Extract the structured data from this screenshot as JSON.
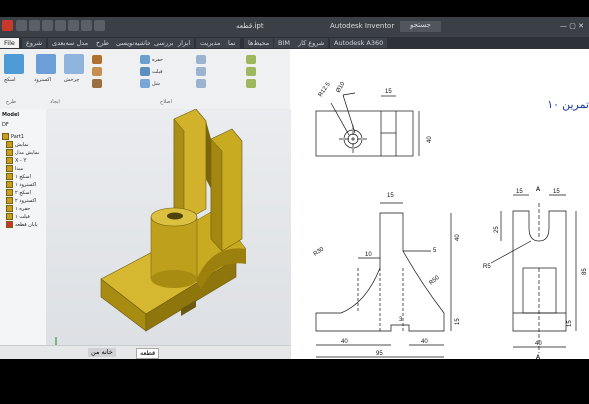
{
  "window": {
    "title": "Autodesk Inventor",
    "doc_name": "قطعه.ipt",
    "search_placeholder": "جستجو",
    "file_menu": "File"
  },
  "tabs": [
    {
      "label": "شروع"
    },
    {
      "label": "مدل سه‌بعدی"
    },
    {
      "label": "طرح"
    },
    {
      "label": "حاشیه‌نویسی"
    },
    {
      "label": "بررسی"
    },
    {
      "label": "ابزار"
    },
    {
      "label": "مدیریت"
    },
    {
      "label": "نما"
    },
    {
      "label": "محیط‌ها"
    },
    {
      "label": "BIM"
    },
    {
      "label": "شروع کار"
    },
    {
      "label": "Autodesk A360"
    }
  ],
  "ribbon": {
    "groups": [
      "طرح",
      "ایجاد",
      "اصلاح"
    ],
    "buttons": [
      "اکسترود",
      "چرخش",
      "حفره",
      "فیلت",
      "شل",
      "اسکچ"
    ]
  },
  "browser": {
    "header": "Model",
    "filter": "DF",
    "items": [
      "Part1",
      "نمایش",
      "نمایش مدل",
      "X - Y",
      "مبدا",
      "اسکچ ۱",
      "اکسترود ۱",
      "اسکچ ۲",
      "اکسترود ۲",
      "حفره ۱",
      "فیلت ۱",
      "پایان قطعه"
    ]
  },
  "status": {
    "home_tab": "خانه من",
    "doc_tab": "قطعه"
  },
  "drawing": {
    "title": "تمرین ۱۰",
    "dims": {
      "d_r125": "R12.5",
      "d_d10": "Ø10",
      "d_15a": "15",
      "d_40v": "40",
      "d_15b": "15",
      "d_r30": "R30",
      "d_10": "10",
      "d_5": "5",
      "d_40v2": "40",
      "d_r50": "R50",
      "d_15c": "15",
      "d_3": "3",
      "d_40a": "40",
      "d_40b": "40",
      "d_95": "95",
      "d_15d": "15",
      "d_15e": "15",
      "d_25": "25",
      "d_r5": "R5",
      "d_85": "85",
      "d_15f": "15",
      "d_40h": "40",
      "sec_a1": "A",
      "sec_a2": "A"
    }
  }
}
